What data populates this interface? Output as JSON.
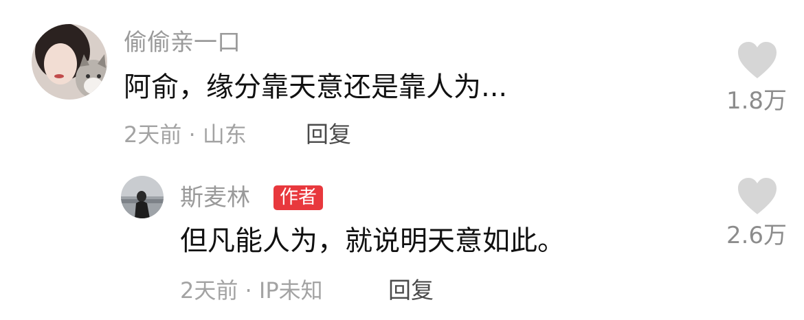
{
  "comments": [
    {
      "username": "偷偷亲一口",
      "text": "阿俞，缘分靠天意还是靠人为...",
      "meta": "2天前 · 山东",
      "reply_label": "回复",
      "likes": "1.8万",
      "avatar_icon": "avatar-woman-with-cat"
    }
  ],
  "replies": [
    {
      "username": "斯麦林",
      "badge": "作者",
      "text": "但凡能人为，就说明天意如此。",
      "meta": "2天前 · IP未知",
      "reply_label": "回复",
      "likes": "2.6万",
      "avatar_icon": "avatar-person-by-sea"
    }
  ],
  "colors": {
    "badge_bg": "#e8383d",
    "like_icon": "#d6d6d6"
  },
  "icons": {
    "like": "heart-icon"
  }
}
